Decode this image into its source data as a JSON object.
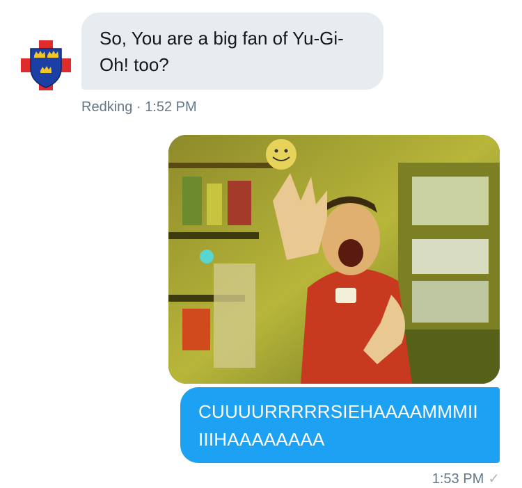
{
  "colors": {
    "incoming_bubble": "#e6ecf0",
    "outgoing_bubble": "#1da1f2",
    "meta_text": "#657786"
  },
  "messages": [
    {
      "direction": "incoming",
      "avatar_icon": "shield-crowns-icon",
      "text": "So, You are a big fan of Yu-Gi-Oh! too?",
      "sender": "Redking",
      "separator": "·",
      "time": "1:52 PM"
    },
    {
      "direction": "outgoing",
      "media": "gif-image",
      "text": "CUUUURRRRRSIEHAAAAMMMIIIIIHAAAAAAAA",
      "time": "1:53 PM",
      "status_icon": "check-icon"
    }
  ]
}
